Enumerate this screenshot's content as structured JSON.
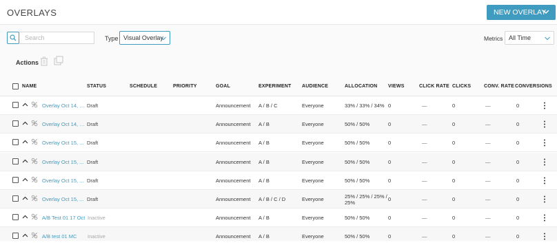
{
  "header": {
    "title": "OVERLAYS",
    "new_button_label": "NEW OVERLAY",
    "accent_color": "#3f9bbf"
  },
  "toolbar": {
    "search_placeholder": "Search",
    "type_label": "Type",
    "type_value": "Visual Overlay",
    "metrics_label": "Metrics",
    "metrics_value": "All Time"
  },
  "actions": {
    "label": "Actions",
    "icons": [
      "trash-icon",
      "copy-icon"
    ]
  },
  "table": {
    "columns": {
      "name": "NAME",
      "status": "STATUS",
      "schedule": "SCHEDULE",
      "priority": "PRIORITY",
      "goal": "GOAL",
      "experiment": "EXPERIMENT",
      "audience": "AUDIENCE",
      "allocation": "ALLOCATION",
      "views": "VIEWS",
      "click_rate": "CLICK RATE",
      "clicks": "CLICKS",
      "conv_rate": "CONV. RATE",
      "conversions": "CONVERSIONS"
    },
    "rows": [
      {
        "name": "Overlay Oct 14, 2...",
        "status": "Draft",
        "goal": "Announcement",
        "experiment": "A / B / C",
        "audience": "Everyone",
        "allocation": "33% / 33% / 34%",
        "views": "0",
        "click_rate": "—",
        "clicks": "0",
        "conv_rate": "—",
        "conversions": "0"
      },
      {
        "name": "Overlay Oct 14, 2...",
        "status": "Draft",
        "goal": "Announcement",
        "experiment": "A / B",
        "audience": "Everyone",
        "allocation": "50% / 50%",
        "views": "0",
        "click_rate": "—",
        "clicks": "0",
        "conv_rate": "—",
        "conversions": "0"
      },
      {
        "name": "Overlay Oct 15, ...",
        "status": "Draft",
        "goal": "Announcement",
        "experiment": "A / B",
        "audience": "Everyone",
        "allocation": "50% / 50%",
        "views": "0",
        "click_rate": "—",
        "clicks": "0",
        "conv_rate": "—",
        "conversions": "0"
      },
      {
        "name": "Overlay Oct 15, ...",
        "status": "Draft",
        "goal": "Announcement",
        "experiment": "A / B",
        "audience": "Everyone",
        "allocation": "50% / 50%",
        "views": "0",
        "click_rate": "—",
        "clicks": "0",
        "conv_rate": "—",
        "conversions": "0"
      },
      {
        "name": "Overlay Oct 15, ...",
        "status": "Draft",
        "goal": "Announcement",
        "experiment": "A / B",
        "audience": "Everyone",
        "allocation": "50% / 50%",
        "views": "0",
        "click_rate": "—",
        "clicks": "0",
        "conv_rate": "—",
        "conversions": "0"
      },
      {
        "name": "Overlay Oct 15, ...",
        "status": "Draft",
        "goal": "Announcement",
        "experiment": "A / B / C / D",
        "audience": "Everyone",
        "allocation": "25% / 25% / 25% / 25%",
        "views": "0",
        "click_rate": "—",
        "clicks": "0",
        "conv_rate": "—",
        "conversions": "0"
      },
      {
        "name": "A/B Test 01 17 Oct",
        "status": "Inactive",
        "goal": "Announcement",
        "experiment": "A / B",
        "audience": "Everyone",
        "allocation": "50% / 50%",
        "views": "0",
        "click_rate": "—",
        "clicks": "0",
        "conv_rate": "—",
        "conversions": "0"
      },
      {
        "name": "A/B test 01 MC",
        "status": "Inactive",
        "goal": "Announcement",
        "experiment": "A / B",
        "audience": "Everyone",
        "allocation": "50% / 50%",
        "views": "0",
        "click_rate": "—",
        "clicks": "0",
        "conv_rate": "—",
        "conversions": "0"
      }
    ]
  }
}
